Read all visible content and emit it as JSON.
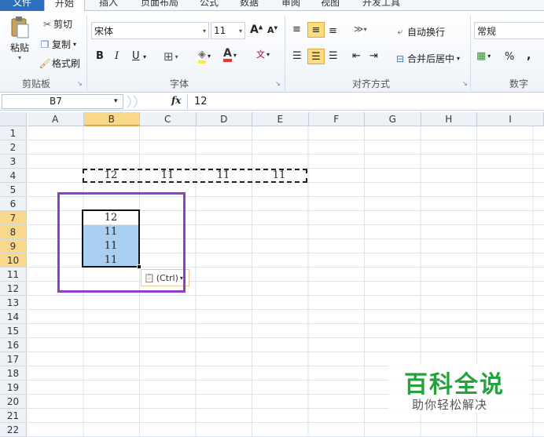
{
  "tabs": {
    "file": "文件",
    "home": "开始",
    "insert": "插入",
    "page_layout": "页面布局",
    "formulas": "公式",
    "data": "数据",
    "review": "审阅",
    "view": "视图",
    "developer": "开发工具"
  },
  "clipboard": {
    "paste": "粘贴",
    "cut": "剪切",
    "copy": "复制",
    "format_painter": "格式刷",
    "group_label": "剪贴板"
  },
  "font": {
    "name": "宋体",
    "size": "11",
    "bold": "B",
    "italic": "I",
    "underline": "U",
    "font_color_glyph": "A",
    "group_label": "字体"
  },
  "alignment": {
    "wrap_text": "自动换行",
    "merge_center": "合并后居中",
    "group_label": "对齐方式"
  },
  "number": {
    "format": "常规",
    "percent": "%",
    "comma": ",",
    "group_label": "数字"
  },
  "formula_bar": {
    "name_box": "B7",
    "fx": "fx",
    "content": "12"
  },
  "columns": [
    "A",
    "B",
    "C",
    "D",
    "E",
    "F",
    "G",
    "H",
    "I"
  ],
  "rows": [
    "1",
    "2",
    "3",
    "4",
    "5",
    "6",
    "7",
    "8",
    "9",
    "10",
    "11",
    "12",
    "13",
    "14",
    "15",
    "16",
    "17",
    "18",
    "19",
    "20",
    "21",
    "22"
  ],
  "cells": {
    "B4": "12",
    "C4": "11",
    "D4": "11",
    "E4": "11",
    "B7": "12",
    "B8": "11",
    "B9": "11",
    "B10": "11"
  },
  "paste_options": {
    "label": "(Ctrl)"
  },
  "watermark": {
    "title": "百科全说",
    "subtitle": "助你轻松解决"
  },
  "colors": {
    "accent_tab": "#2e6fbd",
    "selection_fill": "#a9cff1",
    "annotation_frame": "#8f3fbf",
    "watermark_green": "#25a23c"
  }
}
